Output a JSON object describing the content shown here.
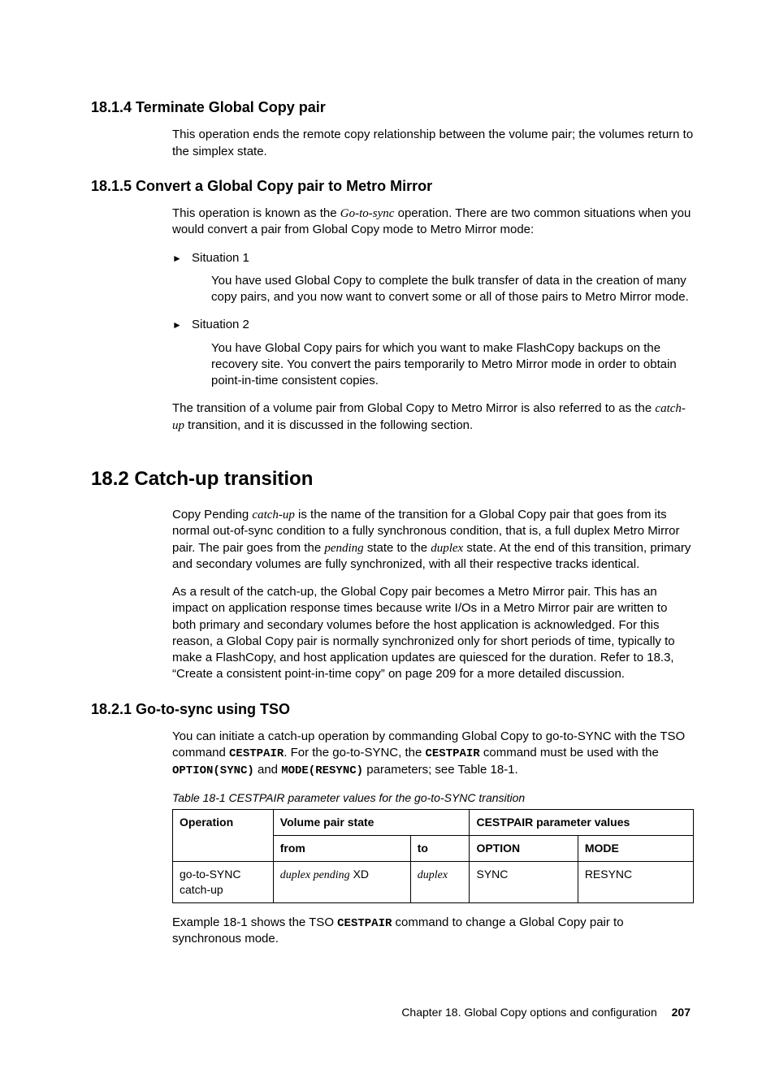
{
  "sec_18_1_4": {
    "heading": "18.1.4  Terminate Global Copy pair",
    "p1": "This operation ends the remote copy relationship between the volume pair; the volumes return to the simplex state."
  },
  "sec_18_1_5": {
    "heading": "18.1.5  Convert a Global Copy pair to Metro Mirror",
    "intro_a": "This operation is known as the ",
    "intro_em": "Go-to-sync",
    "intro_b": " operation. There are two common situations when you would convert a pair from Global Copy mode to Metro Mirror mode:",
    "li1_label": "Situation 1",
    "li1_text": "You have used Global Copy to complete the bulk transfer of data in the creation of many copy pairs, and you now want to convert some or all of those pairs to Metro Mirror mode.",
    "li2_label": "Situation 2",
    "li2_text": "You have Global Copy pairs for which you want to make FlashCopy backups on the recovery site. You convert the pairs temporarily to Metro Mirror mode in order to obtain point-in-time consistent copies.",
    "outro_a": "The transition of a volume pair from Global Copy to Metro Mirror is also referred to as the ",
    "outro_em": "catch-up",
    "outro_b": " transition, and it is discussed in the following section."
  },
  "sec_18_2": {
    "heading": "18.2  Catch-up transition",
    "p1_a": "Copy Pending ",
    "p1_em1": "catch-up",
    "p1_b": " is the name of the transition for a Global Copy pair that goes from its normal out-of-sync condition to a fully synchronous condition, that is, a full duplex Metro Mirror pair. The pair goes from the ",
    "p1_em2": "pending",
    "p1_c": " state to the ",
    "p1_em3": "duplex",
    "p1_d": " state. At the end of this transition, primary and secondary volumes are fully synchronized, with all their respective tracks identical.",
    "p2": "As a result of the catch-up, the Global Copy pair becomes a Metro Mirror pair. This has an impact on application response times because write I/Os in a Metro Mirror pair are written to both primary and secondary volumes before the host application is acknowledged. For this reason, a Global Copy pair is normally synchronized only for short periods of time, typically to make a FlashCopy, and host application updates are quiesced for the duration. Refer to 18.3, “Create a consistent point-in-time copy” on page 209 for a more detailed discussion."
  },
  "sec_18_2_1": {
    "heading": "18.2.1  Go-to-sync using TSO",
    "p1_a": "You can initiate a catch-up operation by commanding Global Copy to go-to-SYNC with the TSO command ",
    "p1_m1": "CESTPAIR",
    "p1_b": ". For the go-to-SYNC, the ",
    "p1_m2": "CESTPAIR",
    "p1_c": " command must be used with the ",
    "p1_m3": "OPTION(SYNC)",
    "p1_d": " and ",
    "p1_m4": "MODE(RESYNC)",
    "p1_e": " parameters; see Table 18-1.",
    "caption": "Table 18-1   CESTPAIR parameter values for the go-to-SYNC transition",
    "p2_a": "Example 18-1 shows the TSO ",
    "p2_m1": "CESTPAIR",
    "p2_b": " command to change a Global Copy pair to synchronous mode."
  },
  "table": {
    "h_operation": "Operation",
    "h_volpair": "Volume pair state",
    "h_cestpair": "CESTPAIR parameter values",
    "h_from": "from",
    "h_to": "to",
    "h_option": "OPTION",
    "h_mode": "MODE",
    "r1_op_a": "go-to-SYNC",
    "r1_op_b": "catch-up",
    "r1_from_em": "duplex pending",
    "r1_from_tail": " XD",
    "r1_to_em": "duplex",
    "r1_option": "SYNC",
    "r1_mode": "RESYNC"
  },
  "footer": {
    "chapter": "Chapter 18. Global Copy options and configuration",
    "page": "207"
  }
}
